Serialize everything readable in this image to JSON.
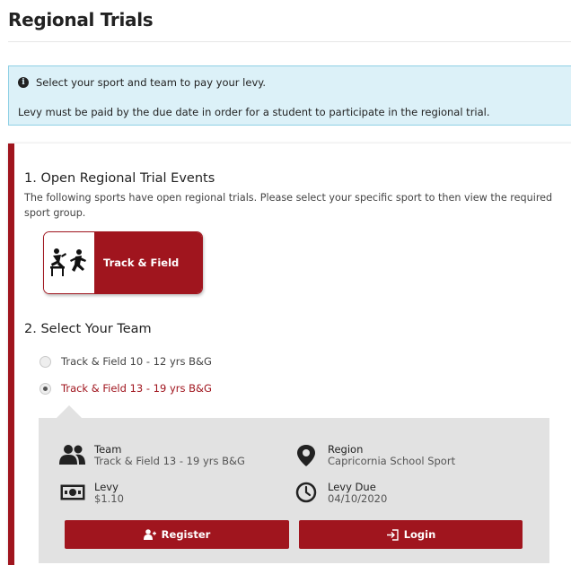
{
  "page": {
    "title": "Regional Trials"
  },
  "info": {
    "line1": "Select your sport and team to pay your levy.",
    "line2": "Levy must be paid by the due date in order for a student to participate in the regional trial."
  },
  "step1": {
    "title": "1. Open Regional Trial Events",
    "description": "The following sports have open regional trials. Please select your specific sport to then view the required sport group.",
    "sport_card": {
      "icon": "hurdler-sprinter-icon",
      "label": "Track & Field"
    }
  },
  "step2": {
    "title": "2. Select Your Team",
    "options": [
      {
        "label": "Track & Field 10 - 12 yrs B&G",
        "selected": false
      },
      {
        "label": "Track & Field 13 - 19 yrs B&G",
        "selected": true
      }
    ]
  },
  "details": {
    "team": {
      "label": "Team",
      "value": "Track & Field 13 - 19 yrs B&G",
      "icon": "users-icon"
    },
    "region": {
      "label": "Region",
      "value": "Capricornia School Sport",
      "icon": "map-pin-icon"
    },
    "levy": {
      "label": "Levy",
      "value": "$1.10",
      "icon": "money-icon"
    },
    "levy_due": {
      "label": "Levy Due",
      "value": "04/10/2020",
      "icon": "clock-icon"
    }
  },
  "buttons": {
    "register": {
      "label": "Register",
      "icon": "add-user-icon"
    },
    "login": {
      "label": "Login",
      "icon": "sign-in-icon"
    }
  },
  "colors": {
    "accent": "#a0151e",
    "info_bg": "#dcf1f8",
    "info_border": "#8fd0e5",
    "detail_bg": "#e2e2e2"
  }
}
